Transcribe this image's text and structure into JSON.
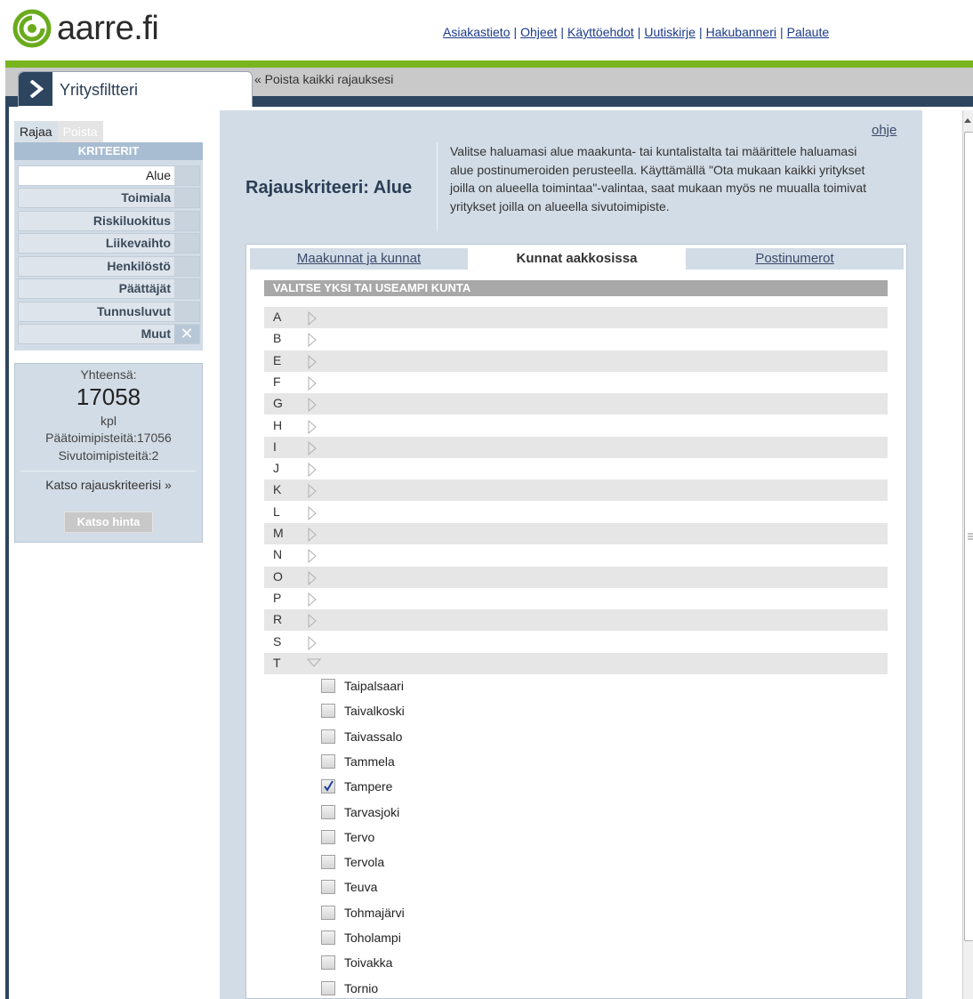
{
  "brand": {
    "name": "aarre.fi",
    "logo_icon": "aarre-ring-logo"
  },
  "header_links": [
    {
      "label": "Asiakastieto"
    },
    {
      "label": "Ohjeet"
    },
    {
      "label": "Käyttöehdot"
    },
    {
      "label": "Uutiskirje"
    },
    {
      "label": "Hakubanneri"
    },
    {
      "label": "Palaute"
    }
  ],
  "separator": "|",
  "app": {
    "title": "Yritysfiltteri",
    "remove_all": "« Poista kaikki rajauksesi"
  },
  "sidebar": {
    "tab_filter": "Rajaa",
    "tab_remove": "Poista",
    "criteria_header": "KRITEERIT",
    "criteria": [
      {
        "label": "Alue",
        "active": true
      },
      {
        "label": "Toimiala"
      },
      {
        "label": "Riskiluokitus"
      },
      {
        "label": "Liikevaihto"
      },
      {
        "label": "Henkilöstö"
      },
      {
        "label": "Päättäjät"
      },
      {
        "label": "Tunnusluvut"
      },
      {
        "label": "Muut",
        "clear_icon": "close-icon"
      }
    ]
  },
  "summary": {
    "total_label": "Yhteensä:",
    "total": "17058",
    "unit": "kpl",
    "main_offices": "Päätoimipisteitä:17056",
    "branch_offices": "Sivutoimipisteitä:2",
    "view_criteria_link": "Katso rajauskriteerisi »",
    "price_button": "Katso hinta"
  },
  "main": {
    "help": "ohje",
    "title": "Rajauskriteeri: Alue",
    "description": "Valitse haluamasi alue maakunta- tai kuntalistalta tai määrittele haluamasi alue postinumeroiden perusteella. Käyttämällä \"Ota mukaan kaikki yritykset joilla on alueella toimintaa\"-valintaa, saat mukaan myös ne muualla toimivat yritykset joilla on alueella sivutoimipiste.",
    "tabs": [
      {
        "label": "Maakunnat ja kunnat",
        "active": false
      },
      {
        "label": "Kunnat aakkosissa",
        "active": true
      },
      {
        "label": "Postinumerot",
        "active": false
      }
    ],
    "section_header": "VALITSE YKSI TAI USEAMPI KUNTA",
    "letters": [
      {
        "letter": "A",
        "expanded": false
      },
      {
        "letter": "B",
        "expanded": false
      },
      {
        "letter": "E",
        "expanded": false
      },
      {
        "letter": "F",
        "expanded": false
      },
      {
        "letter": "G",
        "expanded": false
      },
      {
        "letter": "H",
        "expanded": false
      },
      {
        "letter": "I",
        "expanded": false
      },
      {
        "letter": "J",
        "expanded": false
      },
      {
        "letter": "K",
        "expanded": false
      },
      {
        "letter": "L",
        "expanded": false
      },
      {
        "letter": "M",
        "expanded": false
      },
      {
        "letter": "N",
        "expanded": false
      },
      {
        "letter": "O",
        "expanded": false
      },
      {
        "letter": "P",
        "expanded": false
      },
      {
        "letter": "R",
        "expanded": false
      },
      {
        "letter": "S",
        "expanded": false
      },
      {
        "letter": "T",
        "expanded": true
      }
    ],
    "towns": [
      {
        "name": "Taipalsaari",
        "checked": false
      },
      {
        "name": "Taivalkoski",
        "checked": false
      },
      {
        "name": "Taivassalo",
        "checked": false
      },
      {
        "name": "Tammela",
        "checked": false
      },
      {
        "name": "Tampere",
        "checked": true
      },
      {
        "name": "Tarvasjoki",
        "checked": false
      },
      {
        "name": "Tervo",
        "checked": false
      },
      {
        "name": "Tervola",
        "checked": false
      },
      {
        "name": "Teuva",
        "checked": false
      },
      {
        "name": "Tohmajärvi",
        "checked": false
      },
      {
        "name": "Toholampi",
        "checked": false
      },
      {
        "name": "Toivakka",
        "checked": false
      },
      {
        "name": "Tornio",
        "checked": false
      }
    ]
  },
  "colors": {
    "brand_green": "#78b51e",
    "navy": "#2e4560",
    "panel_blue": "#d2dce6",
    "link_blue": "#1a3a8a"
  }
}
